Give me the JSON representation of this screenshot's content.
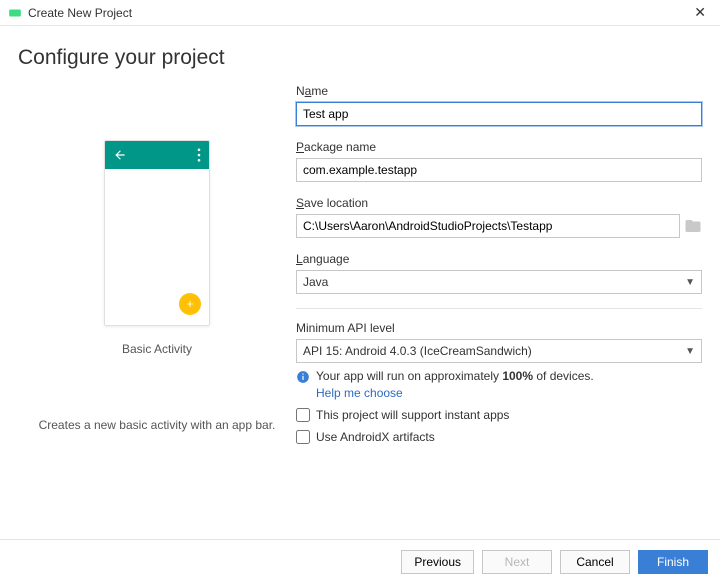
{
  "window": {
    "title": "Create New Project"
  },
  "header": {
    "title": "Configure your project"
  },
  "preview": {
    "label": "Basic Activity",
    "description": "Creates a new basic activity with an app bar."
  },
  "form": {
    "name": {
      "label_pre": "N",
      "label_ul": "a",
      "label_post": "me",
      "value": "Test app"
    },
    "package": {
      "label_ul": "P",
      "label_post": "ackage name",
      "value": "com.example.testapp"
    },
    "save": {
      "label_ul": "S",
      "label_post": "ave location",
      "value": "C:\\Users\\Aaron\\AndroidStudioProjects\\Testapp"
    },
    "language": {
      "label_ul": "L",
      "label_post": "anguage",
      "value": "Java"
    },
    "api": {
      "section_label": "Minimum API level",
      "value": "API 15: Android 4.0.3 (IceCreamSandwich)",
      "info_pre": "Your app will run on approximately ",
      "info_bold": "100%",
      "info_post": " of devices.",
      "help": "Help me choose"
    },
    "instant": {
      "label": "This project will support instant apps",
      "checked": false
    },
    "androidx": {
      "label": "Use AndroidX artifacts",
      "checked": false
    }
  },
  "footer": {
    "previous": "Previous",
    "next": "Next",
    "cancel": "Cancel",
    "finish": "Finish"
  }
}
